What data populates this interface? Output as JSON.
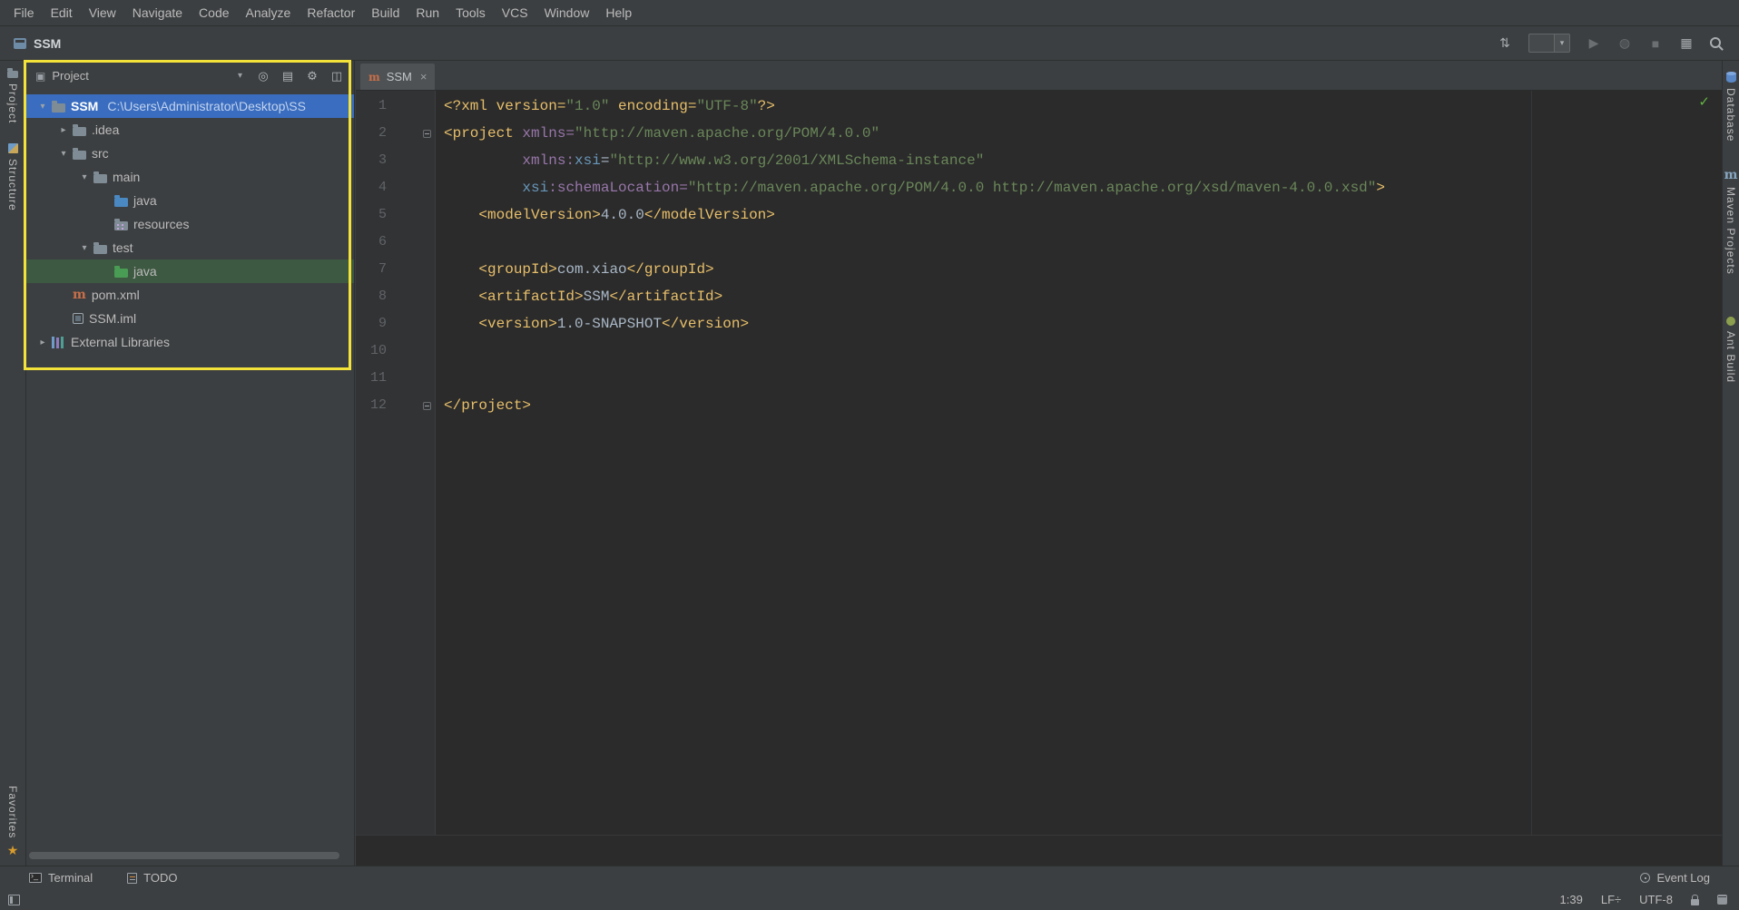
{
  "colors": {
    "selection": "#3a6dbf",
    "test_highlight": "#3e5942",
    "annotation": "#f3e23a",
    "editor_bg": "#2b2b2b",
    "panel_bg": "#3c3f41"
  },
  "menu_bar": {
    "items": [
      "File",
      "Edit",
      "View",
      "Navigate",
      "Code",
      "Analyze",
      "Refactor",
      "Build",
      "Run",
      "Tools",
      "VCS",
      "Window",
      "Help"
    ]
  },
  "toolbar": {
    "project_name": "SSM",
    "right_icons": [
      {
        "name": "sync-icon"
      },
      {
        "name": "run-config-dropdown"
      },
      {
        "name": "run-icon"
      },
      {
        "name": "coverage-icon"
      },
      {
        "name": "stop-icon"
      },
      {
        "name": "restore-layout-icon"
      },
      {
        "name": "search-everywhere-icon"
      }
    ]
  },
  "left_stripe": {
    "top": [
      {
        "icon": "project-stripe-icon",
        "label": "Project"
      },
      {
        "icon": "structure-stripe-icon",
        "label": "Structure"
      }
    ],
    "bottom": [
      {
        "icon": "favorites-star-icon",
        "label": "Favorites"
      }
    ]
  },
  "right_stripe": [
    {
      "icon": "database-icon",
      "label": "Database"
    },
    {
      "icon": "maven-icon",
      "label": "Maven Projects"
    },
    {
      "icon": "ant-icon",
      "label": "Ant Build"
    }
  ],
  "project_panel": {
    "title": "Project",
    "header_icons": [
      {
        "name": "locate-icon"
      },
      {
        "name": "collapse-all-icon"
      },
      {
        "name": "settings-icon"
      },
      {
        "name": "hide-panel-icon"
      }
    ],
    "tree": [
      {
        "indent": 0,
        "arrow": "down",
        "icon": "folder-icon",
        "label": "SSM",
        "label_bold": true,
        "path": "C:\\Users\\Administrator\\Desktop\\SS",
        "state": "selected"
      },
      {
        "indent": 1,
        "arrow": "right",
        "icon": "folder-icon",
        "label": ".idea"
      },
      {
        "indent": 1,
        "arrow": "down",
        "icon": "folder-icon",
        "label": "src"
      },
      {
        "indent": 2,
        "arrow": "down",
        "icon": "folder-icon",
        "label": "main"
      },
      {
        "indent": 3,
        "arrow": "none",
        "icon": "source-folder-icon",
        "label": "java"
      },
      {
        "indent": 3,
        "arrow": "none",
        "icon": "resources-folder-icon",
        "label": "resources"
      },
      {
        "indent": 2,
        "arrow": "down",
        "icon": "folder-icon",
        "label": "test"
      },
      {
        "indent": 3,
        "arrow": "none",
        "icon": "test-folder-icon",
        "label": "java",
        "state": "highlighted"
      },
      {
        "indent": 1,
        "arrow": "none",
        "icon": "maven-file-icon",
        "label": "pom.xml"
      },
      {
        "indent": 1,
        "arrow": "none",
        "icon": "module-file-icon",
        "label": "SSM.iml"
      },
      {
        "indent": 0,
        "arrow": "right",
        "icon": "libraries-icon",
        "label": "External Libraries"
      }
    ]
  },
  "editor": {
    "tab": {
      "icon": "maven-icon",
      "label": "SSM",
      "close": "×"
    },
    "inspection_mark": "✓",
    "code": {
      "palette": {
        "tag": "#e8bf6a",
        "attr": "#9876aa",
        "ns": "#6897bb",
        "str": "#6a8759",
        "text": "#a9b7c6"
      },
      "lines": [
        {
          "num": "1",
          "fold": "",
          "segs": [
            [
              "<?xml version=",
              "tag"
            ],
            [
              "\"1.0\"",
              "str"
            ],
            [
              " encoding=",
              "tag"
            ],
            [
              "\"UTF-8\"",
              "str"
            ],
            [
              "?>",
              "tag"
            ]
          ]
        },
        {
          "num": "2",
          "fold": "minus",
          "segs": [
            [
              "<project ",
              "tag"
            ],
            [
              "xmlns=",
              "attr"
            ],
            [
              "\"http://maven.apache.org/POM/4.0.0\"",
              "str"
            ]
          ]
        },
        {
          "num": "3",
          "fold": "",
          "segs": [
            [
              "         ",
              "text"
            ],
            [
              "xmlns:",
              "attr"
            ],
            [
              "xsi",
              "ns"
            ],
            [
              "=",
              "text"
            ],
            [
              "\"http://www.w3.org/2001/XMLSchema-instance\"",
              "str"
            ]
          ]
        },
        {
          "num": "4",
          "fold": "",
          "segs": [
            [
              "         ",
              "text"
            ],
            [
              "xsi",
              "ns"
            ],
            [
              ":schemaLocation=",
              "attr"
            ],
            [
              "\"http://maven.apache.org/POM/4.0.0 http://maven.apache.org/xsd/maven-4.0.0.xsd\"",
              "str"
            ],
            [
              ">",
              "tag"
            ]
          ]
        },
        {
          "num": "5",
          "fold": "",
          "segs": [
            [
              "    ",
              "text"
            ],
            [
              "<modelVersion>",
              "tag"
            ],
            [
              "4.0.0",
              "text"
            ],
            [
              "</modelVersion>",
              "tag"
            ]
          ]
        },
        {
          "num": "6",
          "fold": "",
          "segs": []
        },
        {
          "num": "7",
          "fold": "",
          "segs": [
            [
              "    ",
              "text"
            ],
            [
              "<groupId>",
              "tag"
            ],
            [
              "com.xiao",
              "text"
            ],
            [
              "</groupId>",
              "tag"
            ]
          ]
        },
        {
          "num": "8",
          "fold": "",
          "segs": [
            [
              "    ",
              "text"
            ],
            [
              "<artifactId>",
              "tag"
            ],
            [
              "SSM",
              "text"
            ],
            [
              "</artifactId>",
              "tag"
            ]
          ]
        },
        {
          "num": "9",
          "fold": "",
          "segs": [
            [
              "    ",
              "text"
            ],
            [
              "<version>",
              "tag"
            ],
            [
              "1.0-SNAPSHOT",
              "text"
            ],
            [
              "</version>",
              "tag"
            ]
          ]
        },
        {
          "num": "10",
          "fold": "",
          "segs": []
        },
        {
          "num": "11",
          "fold": "",
          "segs": []
        },
        {
          "num": "12",
          "fold": "minus",
          "segs": [
            [
              "</project>",
              "tag"
            ]
          ]
        }
      ]
    }
  },
  "bottom_bar": {
    "left": [
      {
        "icon": "terminal-icon",
        "label": "Terminal"
      },
      {
        "icon": "todo-icon",
        "label": "TODO"
      }
    ],
    "right": [
      {
        "icon": "event-log-icon",
        "label": "Event Log"
      }
    ]
  },
  "status_bar": {
    "items": [
      {
        "name": "caret-position",
        "label": "1:39"
      },
      {
        "name": "line-separator",
        "label": "LF÷"
      },
      {
        "name": "file-encoding",
        "label": "UTF-8"
      }
    ]
  }
}
